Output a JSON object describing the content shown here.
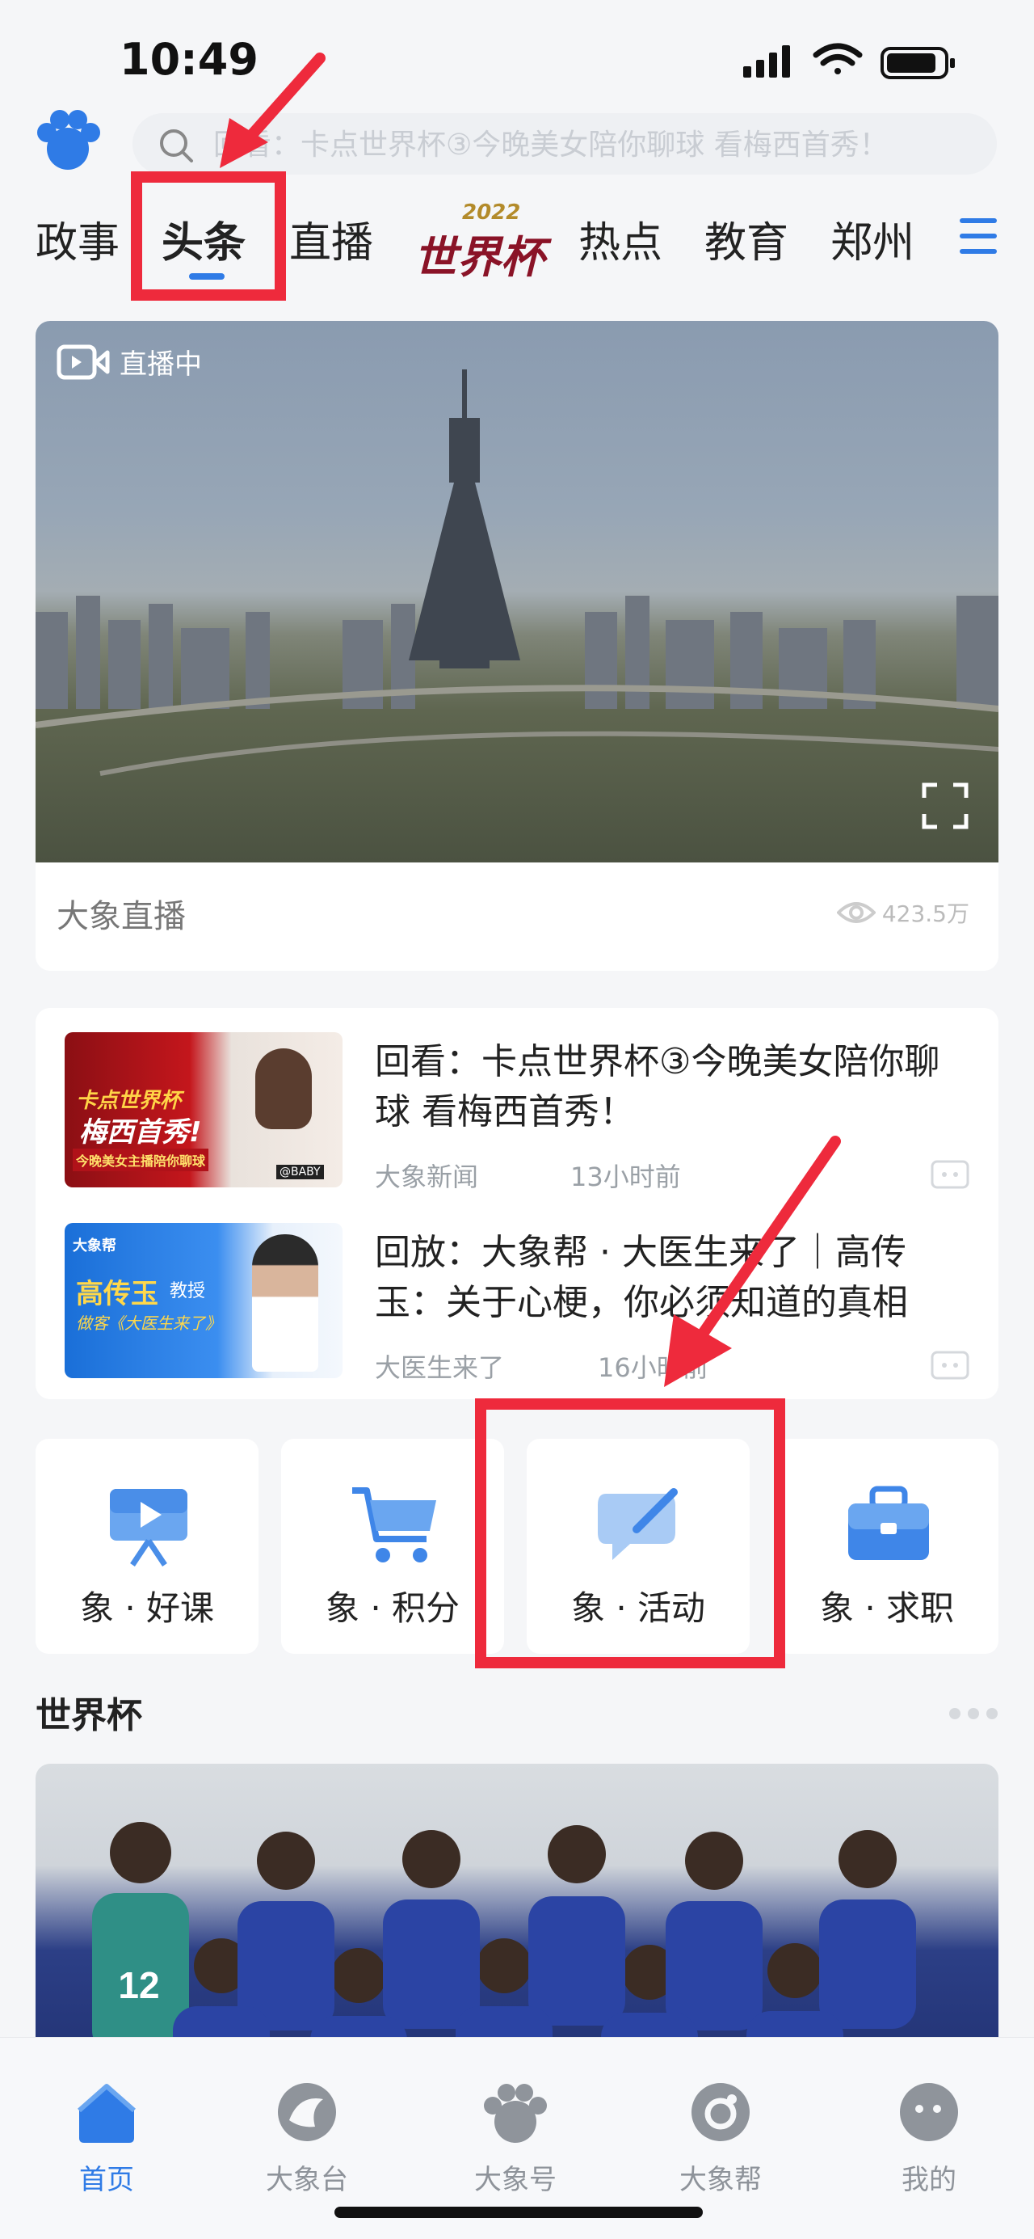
{
  "status_bar": {
    "time": "10:49"
  },
  "header": {
    "search_placeholder": "回看：卡点世界杯③今晚美女陪你聊球 看梅西首秀！"
  },
  "tabs": {
    "items": [
      "政事",
      "头条",
      "直播",
      "热点",
      "教育",
      "郑州"
    ],
    "active": "头条",
    "world_cup_logo_text": "世界杯",
    "world_cup_logo_year": "2022"
  },
  "live": {
    "badge": "直播中",
    "title": "大象直播",
    "views": "423.5万"
  },
  "news": [
    {
      "title": "回看：卡点世界杯③今晚美女陪你聊球 看梅西首秀！",
      "source": "大象新闻",
      "time": "13小时前",
      "thumb_text": [
        "卡点世界杯",
        "梅西首秀!",
        "今晚美女主播陪你聊球",
        "@BABY"
      ]
    },
    {
      "title": "回放：大象帮 · 大医生来了｜高传玉：关于心梗，你必须知道的真相",
      "source": "大医生来了",
      "time": "16小时前",
      "thumb_text": [
        "大象帮",
        "高传玉",
        "教授",
        "做客《大医生来了》"
      ]
    }
  ],
  "quick_services": [
    {
      "label": "象 · 好课",
      "icon": "presentation-icon"
    },
    {
      "label": "象 · 积分",
      "icon": "cart-icon"
    },
    {
      "label": "象 · 活动",
      "icon": "edit-chat-icon"
    },
    {
      "label": "象 · 求职",
      "icon": "briefcase-icon"
    }
  ],
  "section": {
    "title": "世界杯"
  },
  "bottom_nav": [
    {
      "label": "首页",
      "icon": "home-icon",
      "active": true
    },
    {
      "label": "大象台",
      "icon": "tv-icon",
      "active": false
    },
    {
      "label": "大象号",
      "icon": "paw-icon",
      "active": false
    },
    {
      "label": "大象帮",
      "icon": "help-icon",
      "active": false
    },
    {
      "label": "我的",
      "icon": "profile-icon",
      "active": false
    }
  ],
  "colors": {
    "accent": "#2f7be6",
    "annotation": "#ee2a3c"
  }
}
